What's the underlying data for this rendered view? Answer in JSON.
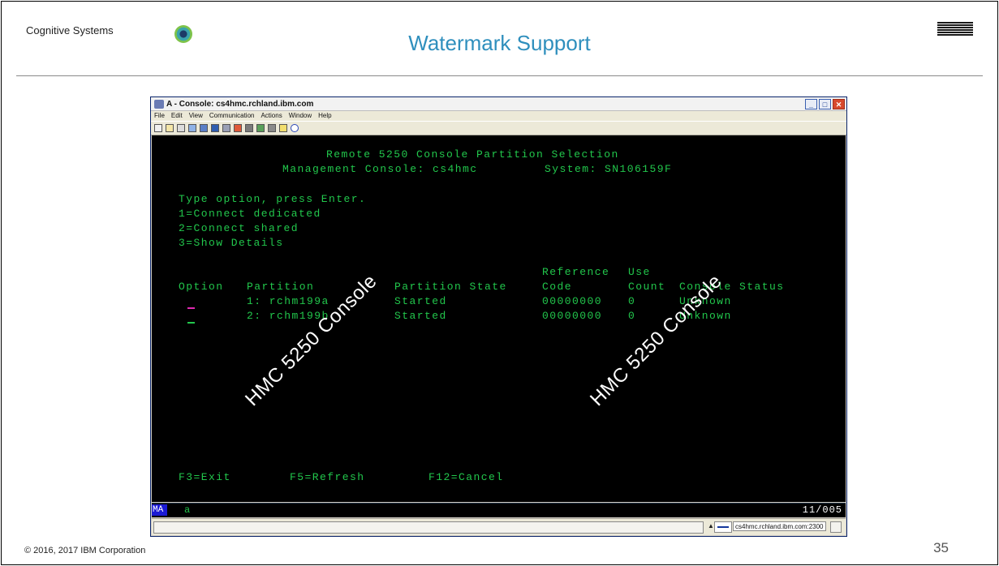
{
  "slide": {
    "brand": "Cognitive Systems",
    "title": "Watermark Support",
    "copyright": "© 2016, 2017 IBM Corporation",
    "page_number": "35"
  },
  "window": {
    "title": "A - Console: cs4hmc.rchland.ibm.com",
    "menu": [
      "File",
      "Edit",
      "View",
      "Communication",
      "Actions",
      "Window",
      "Help"
    ],
    "toolbar_icons": [
      "copy-icon",
      "paste-icon",
      "print-icon",
      "connect-icon",
      "keypad-icon",
      "layout-icon",
      "macro-icon",
      "upload-icon",
      "download-icon",
      "transfer-icon",
      "receive-icon",
      "notes-icon",
      "help-icon"
    ]
  },
  "terminal": {
    "header1": "Remote 5250 Console Partition Selection",
    "header2_console": "Management Console: cs4hmc",
    "header2_system": "System: SN106159F",
    "instructions": [
      "Type option, press Enter.",
      "1=Connect dedicated",
      "2=Connect shared",
      "3=Show Details"
    ],
    "col_ref_top": "Reference",
    "col_use_top": "Use",
    "columns": {
      "option": "Option",
      "partition": "Partition",
      "state": "Partition State",
      "code": "Code",
      "count": "Count",
      "console_status": "Console Status"
    },
    "rows": [
      {
        "partition": "1: rchm199a",
        "state": "Started",
        "code": "00000000",
        "count": "0",
        "status": "Unknown"
      },
      {
        "partition": "2: rchm199b",
        "state": "Started",
        "code": "00000000",
        "count": "0",
        "status": "Unknown"
      }
    ],
    "fkeys": [
      "F3=Exit",
      "F5=Refresh",
      "F12=Cancel"
    ],
    "watermark": "HMC 5250 Console"
  },
  "oia": {
    "mode": "MA",
    "char": "a",
    "position": "11/005"
  },
  "statusbar": {
    "host": "cs4hmc.rchland.ibm.com:2300"
  },
  "colors": {
    "terminal_green": "#22c74c",
    "title_blue": "#2f8fbd",
    "input_magenta": "#e02ab2"
  }
}
